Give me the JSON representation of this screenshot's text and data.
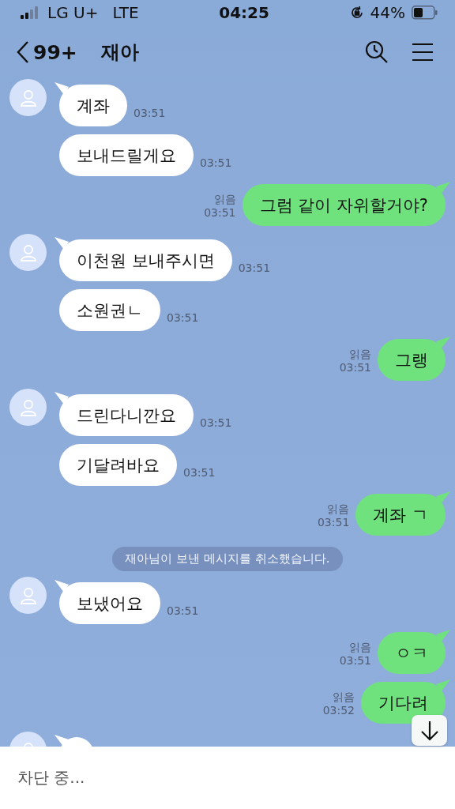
{
  "status_bar": {
    "carrier": "LG U+",
    "network": "LTE",
    "time": "04:25",
    "battery": "44%"
  },
  "header": {
    "back_count": "99+",
    "title": "재아"
  },
  "messages": [
    {
      "kind": "received",
      "first": true,
      "text": "계좌",
      "time": "03:51"
    },
    {
      "kind": "received",
      "first": false,
      "text": "보내드릴게요",
      "time": "03:51"
    },
    {
      "kind": "sent",
      "text": "그럼 같이 자위할거야?",
      "read": "읽음",
      "time": "03:51"
    },
    {
      "kind": "received",
      "first": true,
      "text": "이천원 보내주시면",
      "time": "03:51"
    },
    {
      "kind": "received",
      "first": false,
      "text": "소원권ㄴ",
      "time": "03:51"
    },
    {
      "kind": "sent",
      "text": "그랭",
      "read": "읽음",
      "time": "03:51"
    },
    {
      "kind": "received",
      "first": true,
      "text": "드린다니깐요",
      "time": "03:51"
    },
    {
      "kind": "received",
      "first": false,
      "text": "기달려바요",
      "time": "03:51"
    },
    {
      "kind": "sent",
      "text": "계좌 ㄱ",
      "read": "읽음",
      "time": "03:51"
    },
    {
      "kind": "notice",
      "text": "재아님이 보낸 메시지를 취소했습니다."
    },
    {
      "kind": "received",
      "first": true,
      "text": "보냈어요",
      "time": "03:51"
    },
    {
      "kind": "sent",
      "text": "ㅇㅋ",
      "read": "읽음",
      "time": "03:51"
    },
    {
      "kind": "sent",
      "text": "기다려",
      "read": "읽음",
      "time": "03:52"
    },
    {
      "kind": "received",
      "first": true
    }
  ],
  "input_bar": {
    "placeholder": "차단 중..."
  }
}
